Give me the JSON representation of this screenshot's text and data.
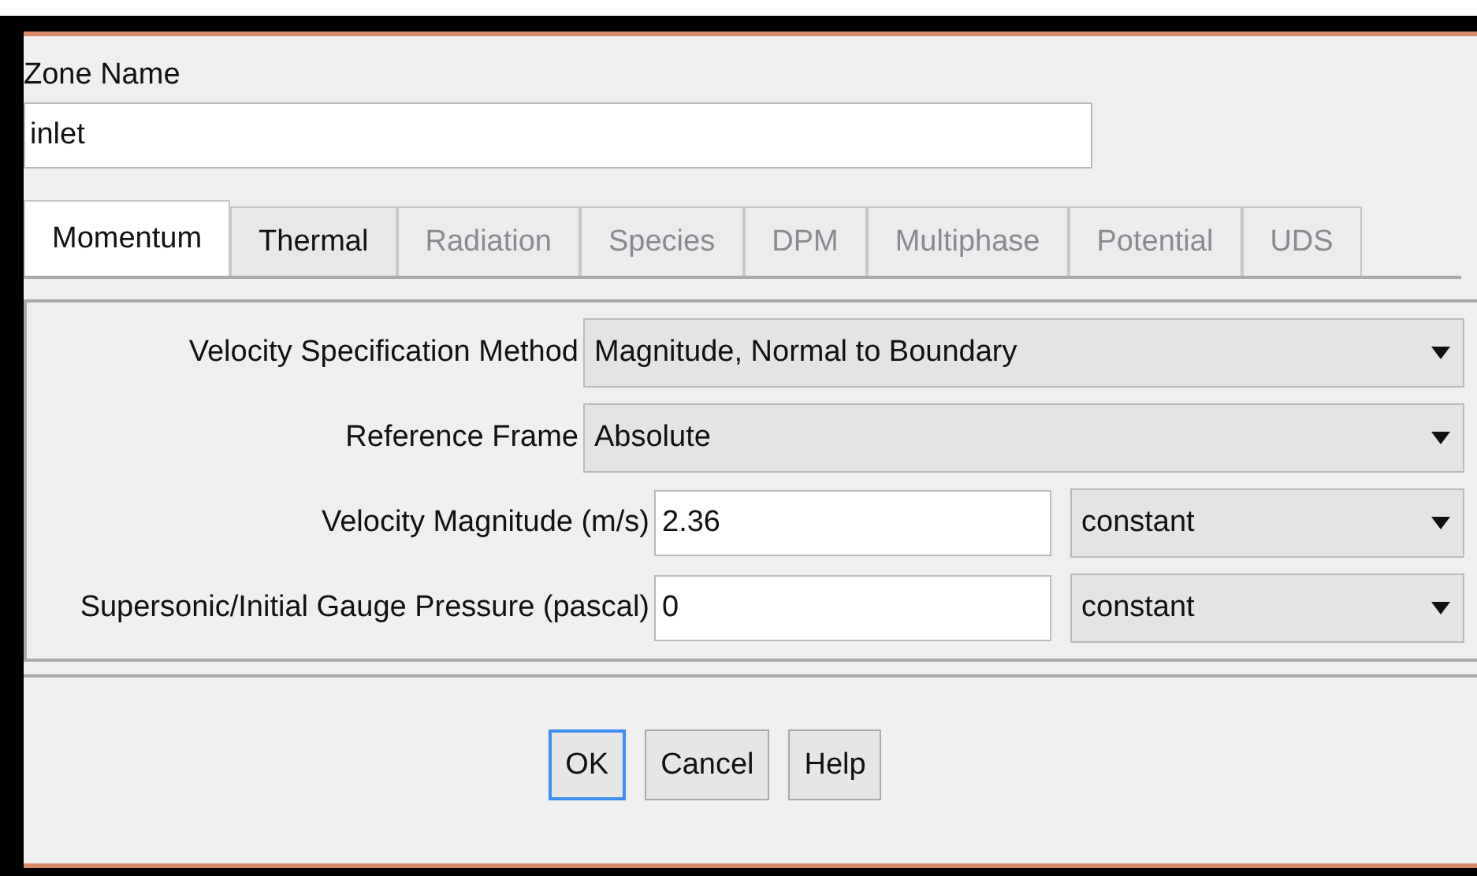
{
  "zone_name": {
    "label": "Zone Name",
    "value": "inlet"
  },
  "tabs": [
    {
      "label": "Momentum",
      "selected": true,
      "disabled": false
    },
    {
      "label": "Thermal",
      "selected": false,
      "disabled": false
    },
    {
      "label": "Radiation",
      "selected": false,
      "disabled": true
    },
    {
      "label": "Species",
      "selected": false,
      "disabled": true
    },
    {
      "label": "DPM",
      "selected": false,
      "disabled": true
    },
    {
      "label": "Multiphase",
      "selected": false,
      "disabled": true
    },
    {
      "label": "Potential",
      "selected": false,
      "disabled": true
    },
    {
      "label": "UDS",
      "selected": false,
      "disabled": true
    }
  ],
  "fields": [
    {
      "kind": "choice",
      "label": "Velocity Specification Method",
      "value": "Magnitude, Normal to Boundary"
    },
    {
      "kind": "choice",
      "label": "Reference Frame",
      "value": "Absolute"
    },
    {
      "kind": "entry",
      "label": "Velocity Magnitude (m/s)",
      "value": "2.36",
      "method": "constant"
    },
    {
      "kind": "entry",
      "label": "Supersonic/Initial Gauge Pressure (pascal)",
      "value": "0",
      "method": "constant"
    }
  ],
  "buttons": [
    {
      "label": "OK",
      "focused": true
    },
    {
      "label": "Cancel",
      "focused": false
    },
    {
      "label": "Help",
      "focused": false
    }
  ]
}
